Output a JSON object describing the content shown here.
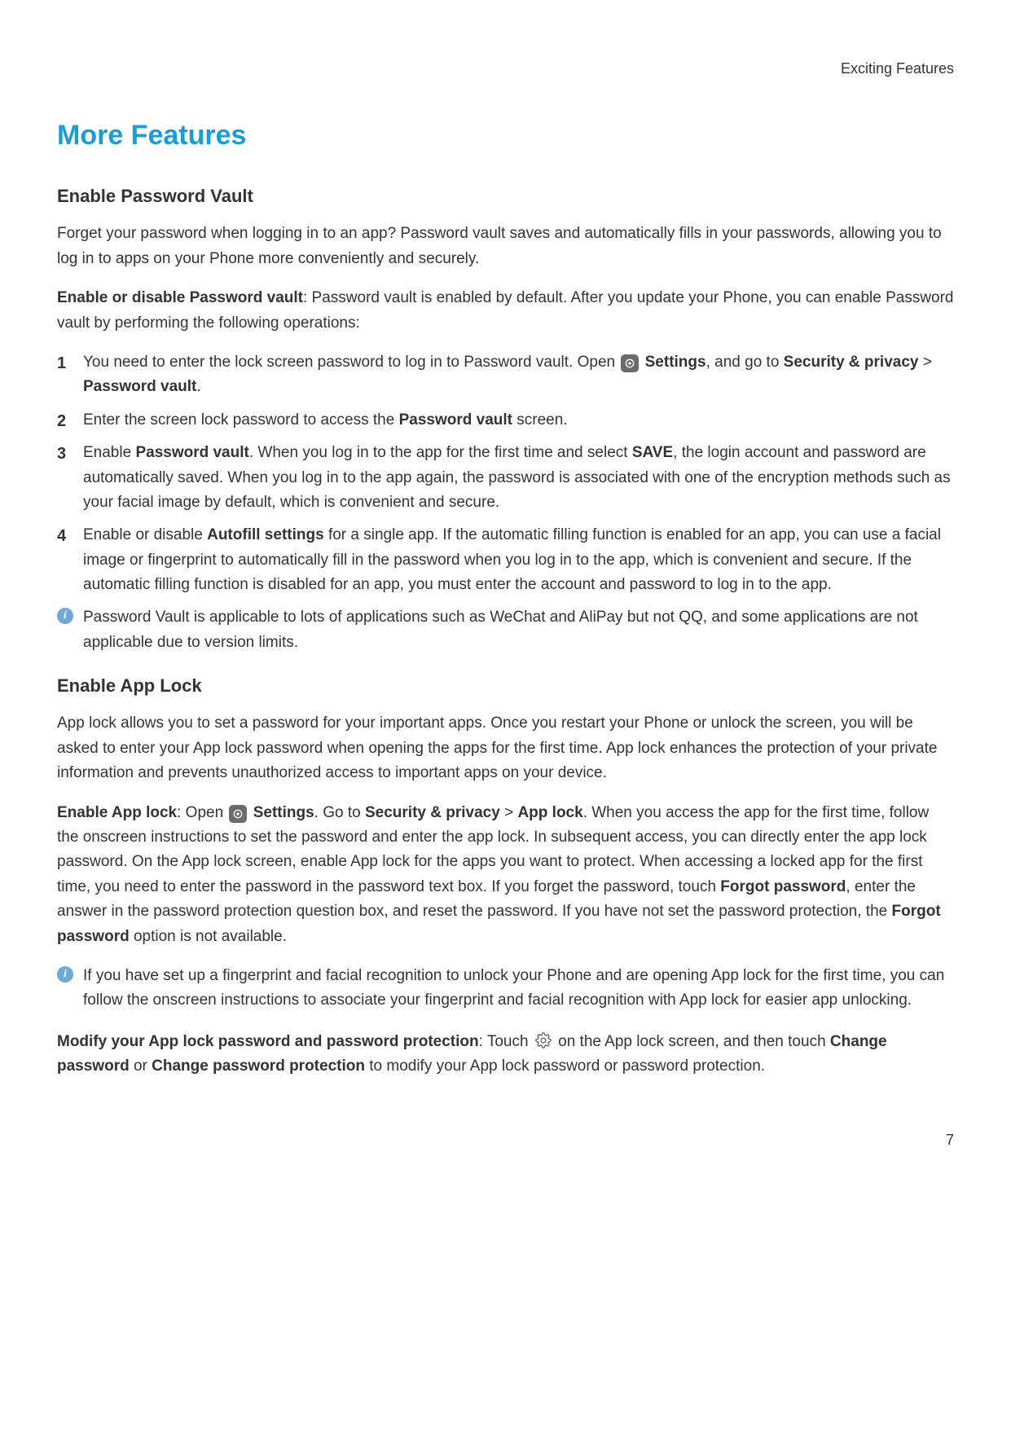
{
  "header": {
    "breadcrumb": "Exciting Features"
  },
  "title": "More Features",
  "pv": {
    "heading": "Enable Password Vault",
    "intro": "Forget your password when logging in to an app? Password vault saves and automatically fills in your passwords, allowing you to log in to apps on your Phone more conveniently and securely.",
    "enable_label": "Enable or disable Password vault",
    "enable_text": ": Password vault is enabled by default. After you update your Phone, you can enable Password vault by performing the following operations:",
    "s1_a": "You need to enter the lock screen password to log in to Password vault. Open ",
    "s1_settings": " Settings",
    "s1_b": ", and go to ",
    "s1_sp": "Security & privacy",
    "s1_gt": " > ",
    "s1_pv": "Password vault",
    "s1_dot": ".",
    "s2_a": "Enter the screen lock password to access the ",
    "s2_pv": "Password vault",
    "s2_b": " screen.",
    "s3_a": "Enable ",
    "s3_pv": "Password vault",
    "s3_b": ". When you log in to the app for the first time and select ",
    "s3_save": "SAVE",
    "s3_c": ", the login account and password are automatically saved. When you log in to the app again, the password is associated with one of the encryption methods such as your facial image by default, which is convenient and secure.",
    "s4_a": "Enable or disable ",
    "s4_af": "Autofill settings",
    "s4_b": " for a single app. If the automatic filling function is enabled for an app, you can use a facial image or fingerprint to automatically fill in the password when you log in to the app, which is convenient and secure. If the automatic filling function is disabled for an app, you must enter the account and password to log in to the app.",
    "note": "Password Vault is applicable to lots of applications such as WeChat and AliPay but not QQ, and some applications are not applicable due to version limits."
  },
  "al": {
    "heading": "Enable App Lock",
    "intro": "App lock allows you to set a password for your important apps. Once you restart your Phone or unlock the screen, you will be asked to enter your App lock password when opening the apps for the first time. App lock enhances the protection of your private information and prevents unauthorized access to important apps on your device.",
    "enable_label": "Enable App lock",
    "p1_a": ": Open ",
    "p1_settings": " Settings",
    "p1_b": ". Go to ",
    "p1_sp": "Security & privacy",
    "p1_gt": " > ",
    "p1_al": "App lock",
    "p1_c": ". When you access the app for the first time, follow the onscreen instructions to set the password and enter the app lock. In subsequent access, you can directly enter the app lock password. On the App lock screen, enable App lock for the apps you want to protect. When accessing a locked app for the first time, you need to enter the password in the password text box. If you forget the password, touch ",
    "p1_fp": "Forgot password",
    "p1_d": ", enter the answer in the password protection question box, and reset the password. If you have not set the password protection, the ",
    "p1_fp2": "Forgot password",
    "p1_e": " option is not available.",
    "note": "If you have set up a fingerprint and facial recognition to unlock your Phone and are opening App lock for the first time, you can follow the onscreen instructions to associate your fingerprint and facial recognition with App lock for easier app unlocking.",
    "modify_label": "Modify your App lock password and password protection",
    "m_a": ": Touch ",
    "m_b": " on the App lock screen, and then touch ",
    "m_cp": "Change password",
    "m_or": " or ",
    "m_cpp": "Change password protection",
    "m_c": " to modify your App lock password or password protection."
  },
  "page_number": "7"
}
